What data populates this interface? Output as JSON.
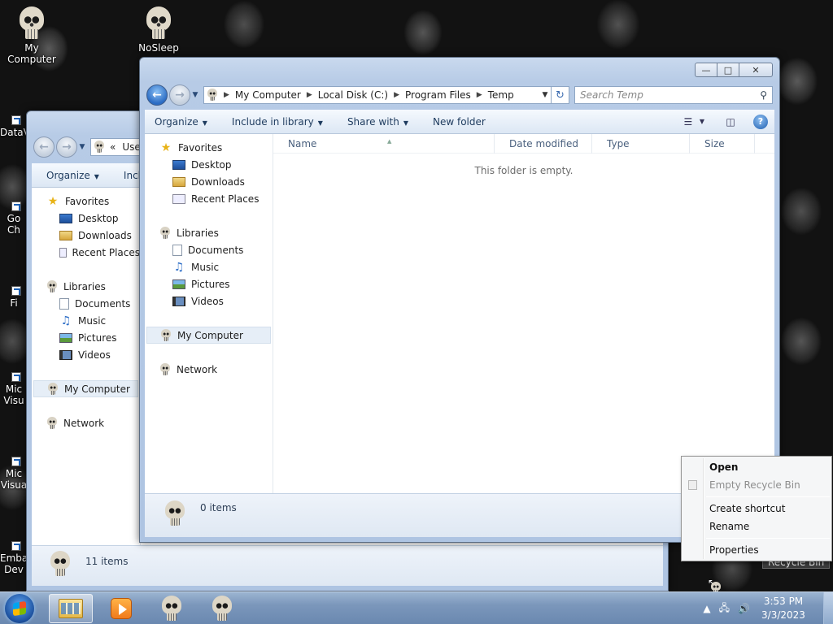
{
  "desktop": {
    "icons": [
      {
        "label": "My Computer"
      },
      {
        "label": "NoSleep"
      }
    ],
    "side_labels": [
      "DataV",
      "Go",
      "Ch",
      "Fi",
      "Mic",
      "Visu",
      "Mic",
      "Visua",
      "Emba",
      "Dev"
    ]
  },
  "front_window": {
    "breadcrumb": [
      "My Computer",
      "Local Disk (C:)",
      "Program Files",
      "Temp"
    ],
    "search_placeholder": "Search Temp",
    "toolbar": {
      "organize": "Organize",
      "include_in_library": "Include in library",
      "share_with": "Share with",
      "new_folder": "New folder"
    },
    "nav": {
      "favorites": "Favorites",
      "desktop": "Desktop",
      "downloads": "Downloads",
      "recent_places": "Recent Places",
      "libraries": "Libraries",
      "documents": "Documents",
      "music": "Music",
      "pictures": "Pictures",
      "videos": "Videos",
      "my_computer": "My Computer",
      "network": "Network"
    },
    "columns": {
      "name": "Name",
      "date_modified": "Date modified",
      "type": "Type",
      "size": "Size"
    },
    "empty_message": "This folder is empty.",
    "status": "0 items"
  },
  "back_window": {
    "breadcrumb_prefix": "«",
    "breadcrumb_text": "Use",
    "toolbar": {
      "organize": "Organize",
      "include_partial": "Inclu"
    },
    "nav": {
      "favorites": "Favorites",
      "desktop": "Desktop",
      "downloads": "Downloads",
      "recent_places": "Recent Places",
      "libraries": "Libraries",
      "documents": "Documents",
      "music": "Music",
      "pictures": "Pictures",
      "videos": "Videos",
      "my_computer": "My Computer",
      "network": "Network"
    },
    "status": "11 items"
  },
  "context_menu": {
    "open": "Open",
    "empty_recycle_bin": "Empty Recycle Bin",
    "create_shortcut": "Create shortcut",
    "rename": "Rename",
    "properties": "Properties"
  },
  "recycle_bin_label": "Recycle Bin",
  "taskbar": {
    "time": "3:53 PM",
    "date": "3/3/2023"
  }
}
